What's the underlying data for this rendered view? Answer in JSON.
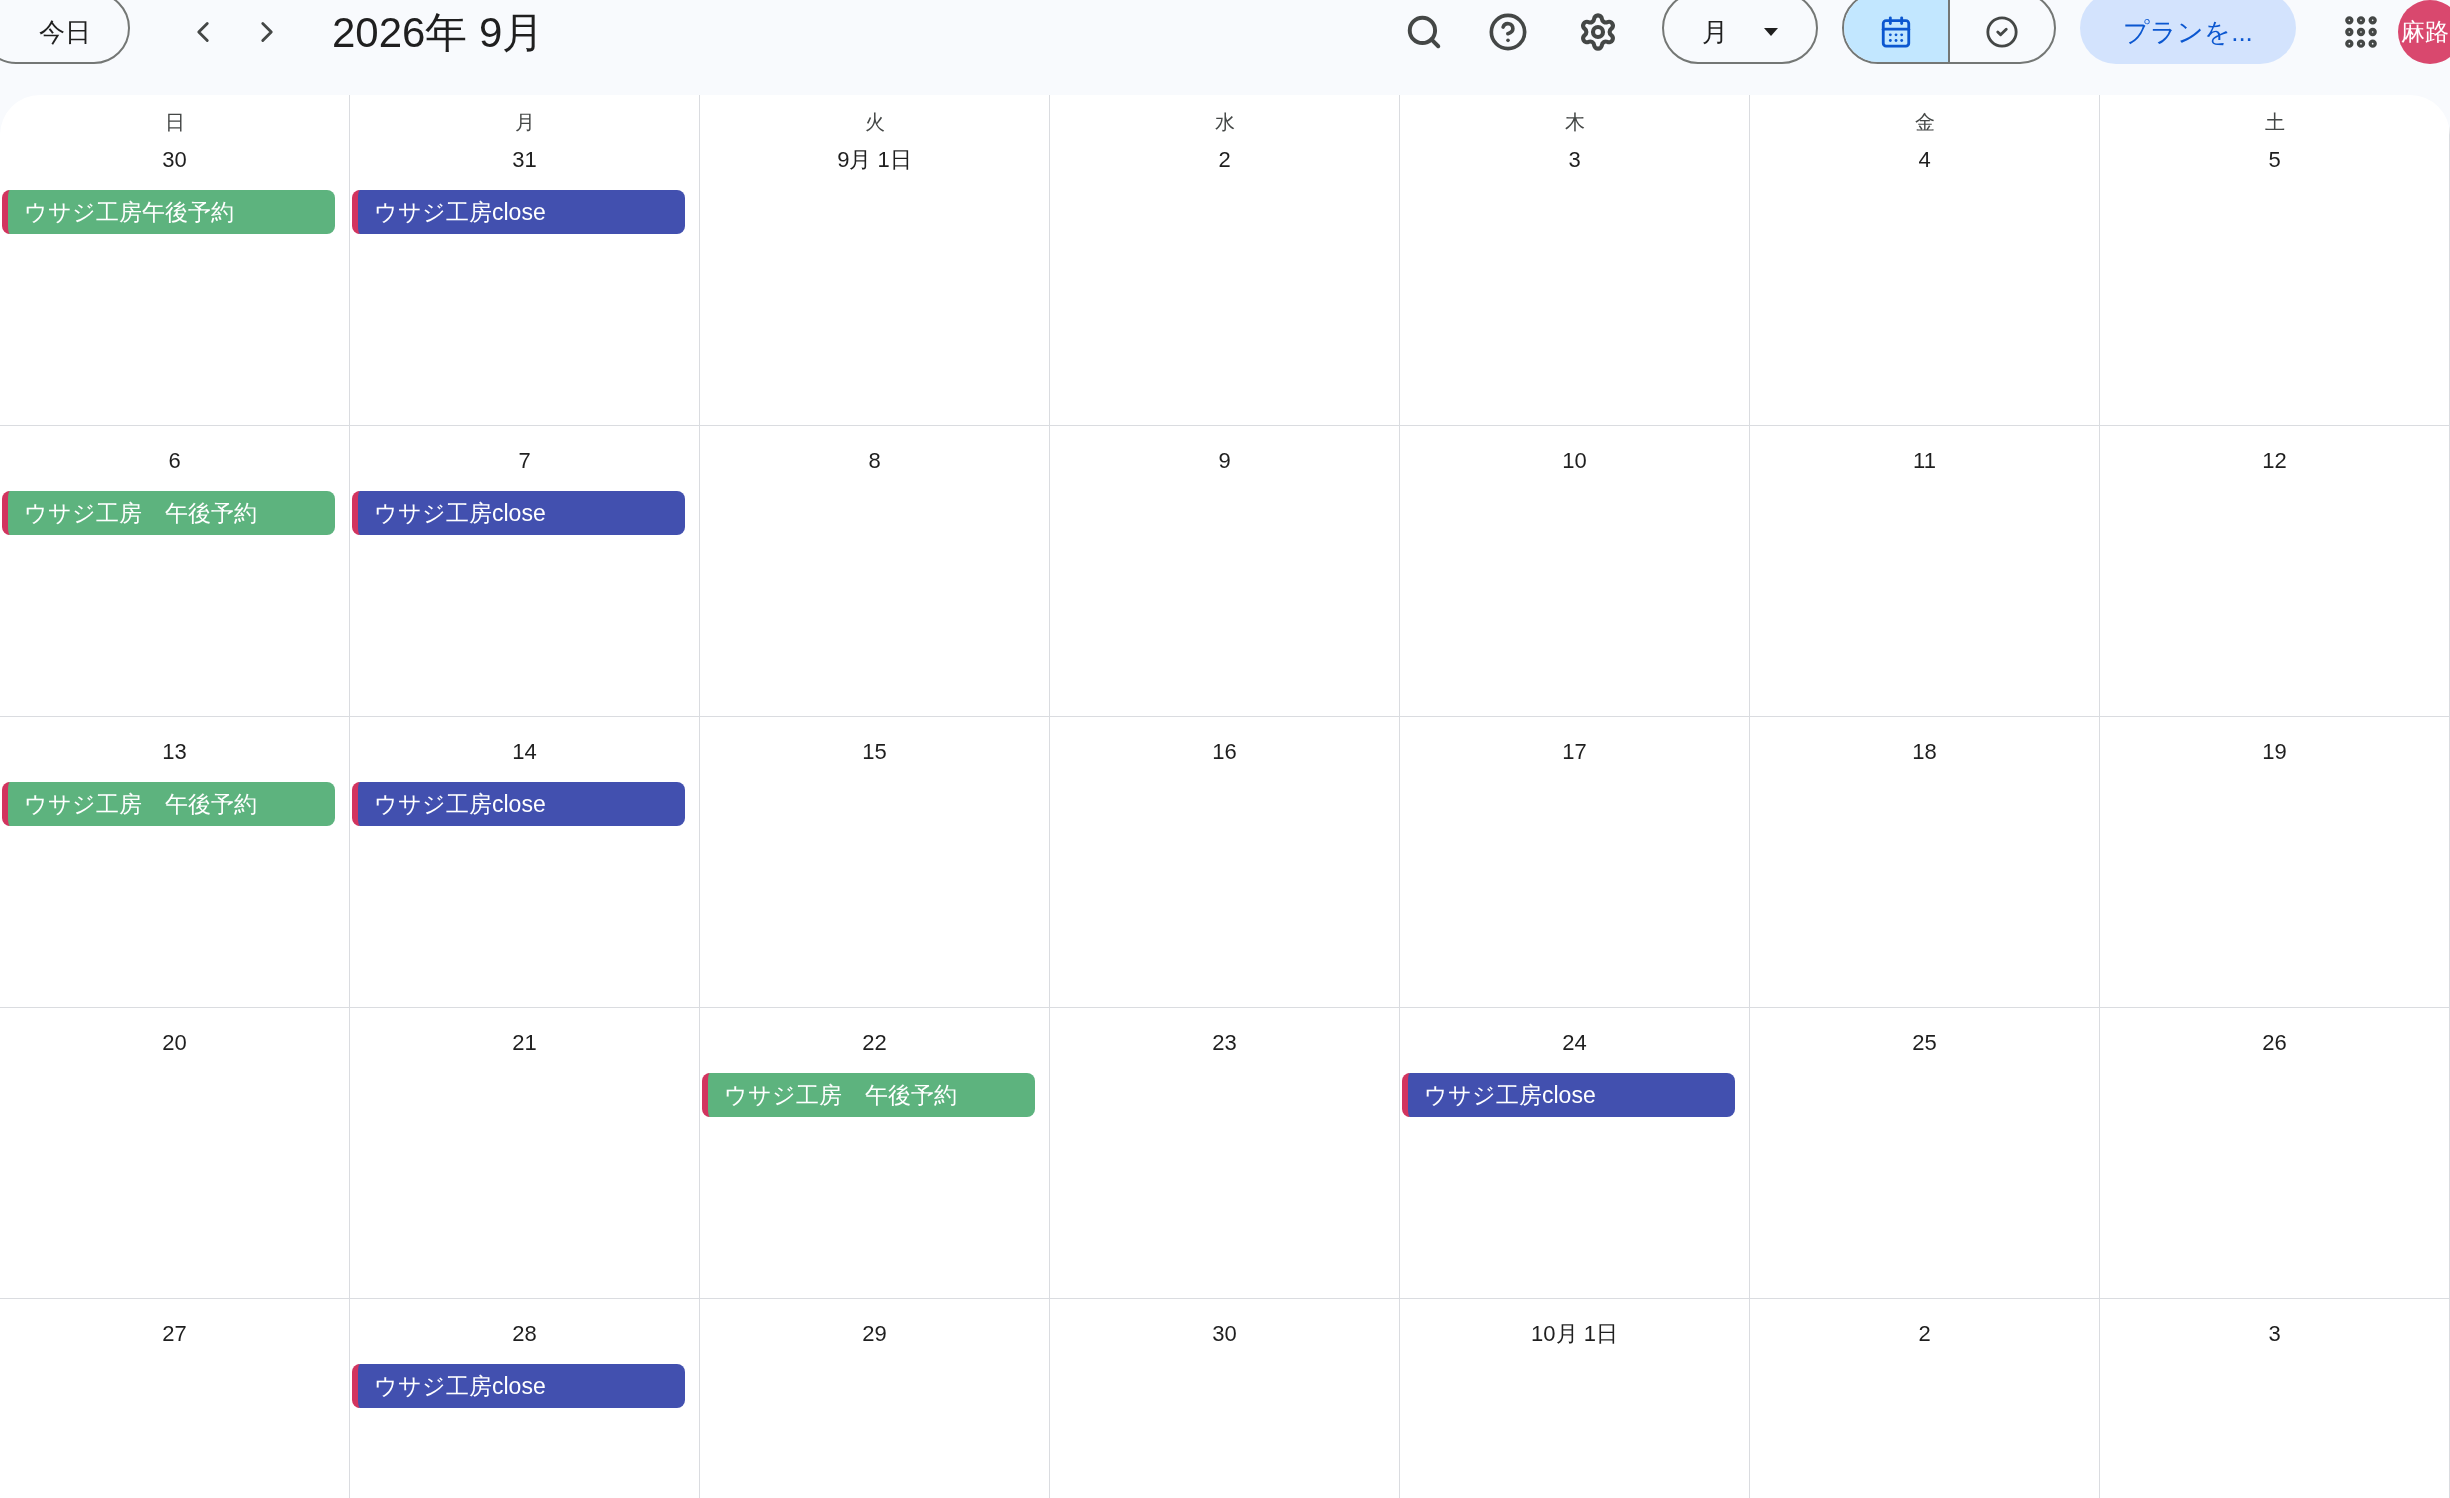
{
  "toolbar": {
    "today_button": "今日",
    "title": "2026年 9月",
    "view_dropdown": "月",
    "view_toggle": [
      {
        "kind": "calendar",
        "selected": true
      },
      {
        "kind": "tasks",
        "selected": false
      }
    ],
    "plan_button": "プランを...",
    "avatar": "麻路"
  },
  "weekdays": [
    "日",
    "月",
    "火",
    "水",
    "木",
    "金",
    "土"
  ],
  "weeks": [
    [
      {
        "date": "30",
        "events": [
          {
            "title": "ウサジ工房午後予約",
            "color": "#5db37e"
          }
        ]
      },
      {
        "date": "31",
        "events": [
          {
            "title": "ウサジ工房close",
            "color": "#4250af"
          }
        ]
      },
      {
        "date": "9月 1日"
      },
      {
        "date": "2"
      },
      {
        "date": "3"
      },
      {
        "date": "4"
      },
      {
        "date": "5"
      }
    ],
    [
      {
        "date": "6",
        "events": [
          {
            "title": "ウサジ工房　午後予約",
            "color": "#5db37e"
          }
        ]
      },
      {
        "date": "7",
        "events": [
          {
            "title": "ウサジ工房close",
            "color": "#4250af"
          }
        ]
      },
      {
        "date": "8"
      },
      {
        "date": "9"
      },
      {
        "date": "10"
      },
      {
        "date": "11"
      },
      {
        "date": "12"
      }
    ],
    [
      {
        "date": "13",
        "events": [
          {
            "title": "ウサジ工房　午後予約",
            "color": "#5db37e"
          }
        ]
      },
      {
        "date": "14",
        "events": [
          {
            "title": "ウサジ工房close",
            "color": "#4250af"
          }
        ]
      },
      {
        "date": "15"
      },
      {
        "date": "16"
      },
      {
        "date": "17"
      },
      {
        "date": "18"
      },
      {
        "date": "19"
      }
    ],
    [
      {
        "date": "20"
      },
      {
        "date": "21"
      },
      {
        "date": "22",
        "events": [
          {
            "title": "ウサジ工房　午後予約",
            "color": "#5db37e"
          }
        ]
      },
      {
        "date": "23"
      },
      {
        "date": "24",
        "events": [
          {
            "title": "ウサジ工房close",
            "color": "#4250af"
          }
        ]
      },
      {
        "date": "25"
      },
      {
        "date": "26"
      }
    ],
    [
      {
        "date": "27"
      },
      {
        "date": "28",
        "events": [
          {
            "title": "ウサジ工房close",
            "color": "#4250af"
          }
        ]
      },
      {
        "date": "29"
      },
      {
        "date": "30"
      },
      {
        "date": "10月 1日"
      },
      {
        "date": "2"
      },
      {
        "date": "3"
      }
    ]
  ]
}
